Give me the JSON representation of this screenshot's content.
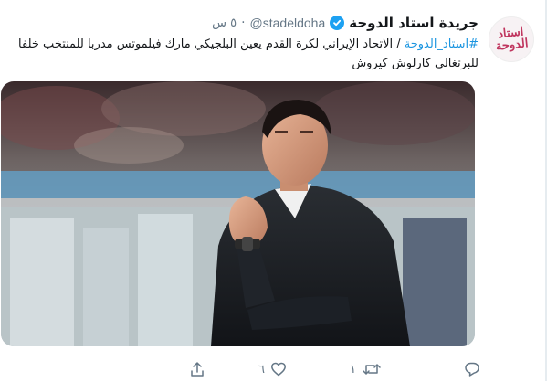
{
  "account": {
    "avatar_text": "استاد الدوحة",
    "name": "جريدة استاد الدوحة",
    "handle": "@stadeldoha",
    "separator": "·",
    "time": "٥ س"
  },
  "tweet": {
    "hashtag": "#استاد_الدوحة",
    "text_rest": " / الاتحاد الإيراني لكرة القدم يعين البلجيكي مارك فيلموتس مدربا للمنتخب خلفا للبرتغالي كارلوش كيروش"
  },
  "actions": {
    "reply_count": "",
    "retweet_count": "١",
    "like_count": "٦",
    "share_count": ""
  },
  "icons": {
    "verified": "verified-badge-icon",
    "reply": "reply-icon",
    "retweet": "retweet-icon",
    "like": "heart-icon",
    "share": "share-icon"
  },
  "colors": {
    "accent": "#1da1f2",
    "hashtag": "#1b95e0",
    "muted": "#657786",
    "avatar_brand": "#c0365f"
  }
}
